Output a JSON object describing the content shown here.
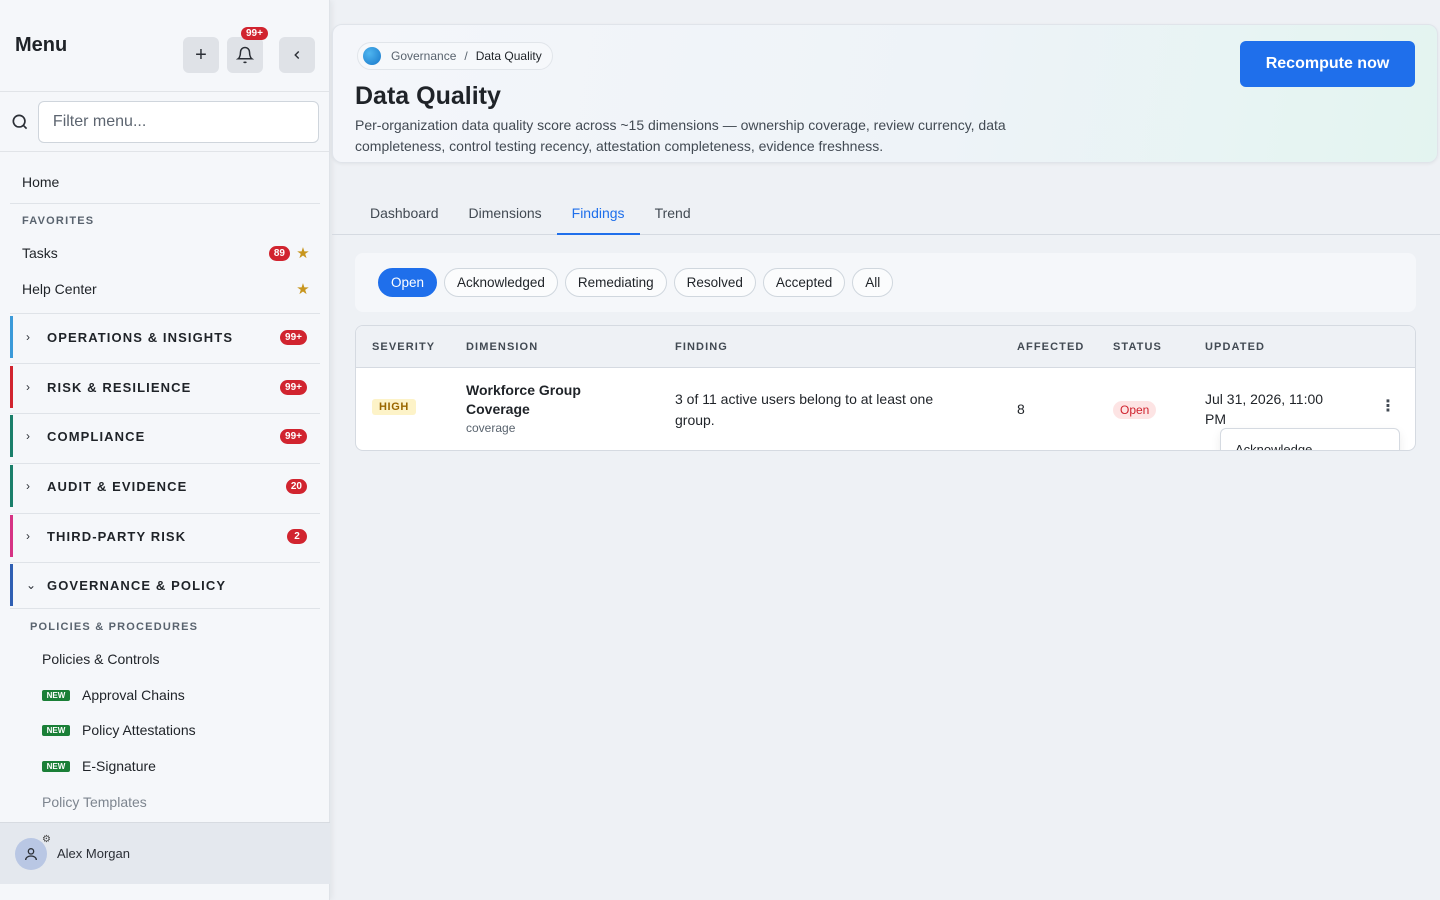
{
  "sidebar": {
    "title": "Menu",
    "add_icon": "plus-icon",
    "notifications": {
      "icon": "bell-icon",
      "badge": "99+"
    },
    "collapse_icon": "chevron-left-icon",
    "filter": {
      "placeholder": "Filter menu...",
      "value": ""
    },
    "home": "Home",
    "favorites_label": "FAVORITES",
    "favorites": [
      {
        "label": "Tasks",
        "badge": "89",
        "starred": true
      },
      {
        "label": "Help Center",
        "badge": "",
        "starred": true
      }
    ],
    "sections": [
      {
        "label": "OPERATIONS & INSIGHTS",
        "badge": "99+",
        "color": "#3b9ad9",
        "expanded": false
      },
      {
        "label": "RISK & RESILIENCE",
        "badge": "99+",
        "color": "#d1242f",
        "expanded": false
      },
      {
        "label": "COMPLIANCE",
        "badge": "99+",
        "color": "#1a7f6a",
        "expanded": false
      },
      {
        "label": "AUDIT & EVIDENCE",
        "badge": "20",
        "color": "#1a7f6a",
        "expanded": false
      },
      {
        "label": "THIRD-PARTY RISK",
        "badge": "2",
        "color": "#d63384",
        "expanded": false
      },
      {
        "label": "GOVERNANCE & POLICY",
        "badge": "",
        "color": "#2f5fb3",
        "expanded": true
      }
    ],
    "subsection_label": "POLICIES & PROCEDURES",
    "sub_items": [
      {
        "label": "Policies & Controls",
        "new": false
      },
      {
        "label": "Approval Chains",
        "new": true
      },
      {
        "label": "Policy Attestations",
        "new": true
      },
      {
        "label": "E-Signature",
        "new": true
      },
      {
        "label": "Policy Templates",
        "new": false
      }
    ],
    "new_tag": "NEW",
    "user": {
      "name": "Alex Morgan"
    }
  },
  "header": {
    "breadcrumb": [
      "Governance",
      "Data Quality"
    ],
    "breadcrumb_sep": "/",
    "title": "Data Quality",
    "description": "Per-organization data quality score across ~15 dimensions — ownership coverage, review currency, data completeness, control testing recency, attestation completeness, evidence freshness.",
    "recompute_label": "Recompute now"
  },
  "tabs": [
    {
      "label": "Dashboard",
      "active": false
    },
    {
      "label": "Dimensions",
      "active": false
    },
    {
      "label": "Findings",
      "active": true
    },
    {
      "label": "Trend",
      "active": false
    }
  ],
  "status_filters": [
    {
      "label": "Open",
      "active": true
    },
    {
      "label": "Acknowledged",
      "active": false
    },
    {
      "label": "Remediating",
      "active": false
    },
    {
      "label": "Resolved",
      "active": false
    },
    {
      "label": "Accepted",
      "active": false
    },
    {
      "label": "All",
      "active": false
    }
  ],
  "table": {
    "columns": [
      "SEVERITY",
      "DIMENSION",
      "FINDING",
      "AFFECTED",
      "STATUS",
      "UPDATED"
    ],
    "rows": [
      {
        "severity": "HIGH",
        "dimension": "Workforce Group Coverage",
        "dimension_key": "coverage",
        "finding": "3 of 11 active users belong to at least one group.",
        "affected": "8",
        "status": "Open",
        "updated": "Jul 31, 2026, 11:00 PM",
        "menu_icon": "kebab-menu-icon"
      }
    ],
    "row_menu": {
      "first_item": "Acknowledge"
    }
  }
}
